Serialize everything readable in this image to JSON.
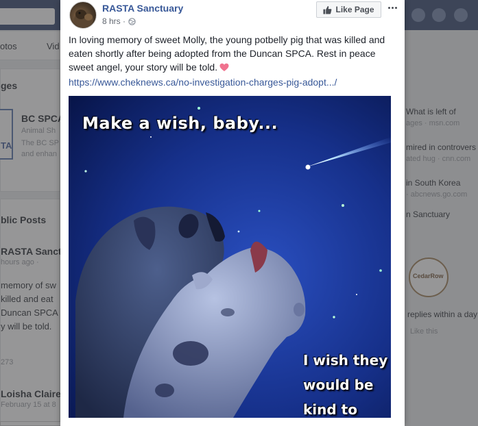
{
  "background": {
    "tabs": [
      "otos",
      "Vid"
    ],
    "sections": {
      "pages": "ges",
      "public_posts": "blic Posts"
    },
    "suggested_page": {
      "name": "BC SPCA",
      "category": "Animal Sh",
      "desc_line1": "The BC SP",
      "desc_line2": "and enhan",
      "logo_text": "TA"
    },
    "public_post": {
      "author": "RASTA Sanct",
      "time": "hours ago ·",
      "line1": "memory of sw",
      "line2": "killed and eat",
      "line3": "Duncan SPCA",
      "line4": "y will be told.",
      "count": "273"
    },
    "commenter": {
      "name": "Loisha Claire",
      "time": "February 15 at 8"
    },
    "right_column": {
      "news": [
        {
          "title": "What is left of",
          "source": "ages · msn.com"
        },
        {
          "title": "mired in controvers",
          "source": "ated hug · cnn.com"
        },
        {
          "title": "in South Korea",
          "source": "· abcnews.go.com"
        }
      ],
      "sanctuary_label": "n Sanctuary",
      "reply_note": "replies within a day",
      "like_note": "Like this",
      "logo_text": "CedarRow"
    }
  },
  "post": {
    "page_name": "RASTA Sanctuary",
    "time": "8 hrs ·",
    "like_button": "Like Page",
    "text": "In loving memory of sweet Molly, the young potbelly pig that was killed and eaten shortly after being adopted from the Duncan SPCA. Rest in peace sweet angel, your story will be told.",
    "link": "https://www.cheknews.ca/no-investigation-charges-pig-adopt.../",
    "image": {
      "caption_top": "Make a wish, baby...",
      "caption_bottom": "I wish they would be kind to us..."
    }
  },
  "colors": {
    "brand_blue": "#385898",
    "night_sky": "#0d1f5e"
  },
  "icons": [
    "avatar",
    "globe-icon",
    "thumbs-up-icon",
    "more-icon",
    "heart-icon"
  ]
}
